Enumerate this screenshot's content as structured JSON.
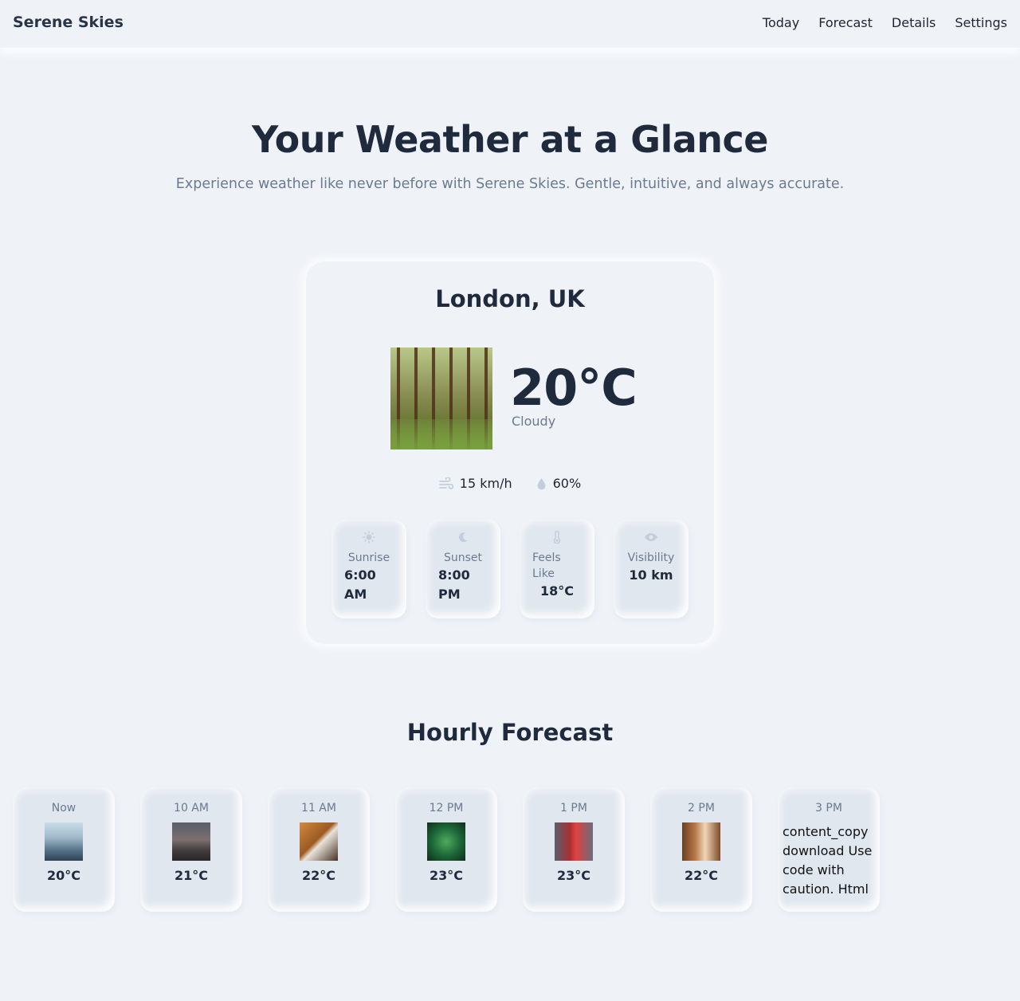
{
  "header": {
    "brand": "Serene Skies",
    "nav": [
      "Today",
      "Forecast",
      "Details",
      "Settings"
    ]
  },
  "hero": {
    "title": "Your Weather at a Glance",
    "subtitle": "Experience weather like never before with Serene Skies. Gentle, intuitive, and always accurate."
  },
  "current": {
    "city": "London, UK",
    "temperature": "20°C",
    "condition": "Cloudy",
    "wind": "15 km/h",
    "humidity": "60%",
    "stats": [
      {
        "icon": "sun-icon",
        "label": "Sunrise",
        "value": "6:00 AM"
      },
      {
        "icon": "moon-icon",
        "label": "Sunset",
        "value": "8:00 PM"
      },
      {
        "icon": "thermometer-icon",
        "label": "Feels Like",
        "value": "18°C"
      },
      {
        "icon": "eye-icon",
        "label": "Visibility",
        "value": "10 km"
      }
    ]
  },
  "hourly": {
    "title": "Hourly Forecast",
    "items": [
      {
        "time": "Now",
        "temp": "20°C"
      },
      {
        "time": "10 AM",
        "temp": "21°C"
      },
      {
        "time": "11 AM",
        "temp": "22°C"
      },
      {
        "time": "12 PM",
        "temp": "23°C"
      },
      {
        "time": "1 PM",
        "temp": "23°C"
      },
      {
        "time": "2 PM",
        "temp": "22°C"
      },
      {
        "time": "3 PM",
        "text": "content_copy download Use code with caution. Html"
      }
    ]
  },
  "colors": {
    "background": "#eff3f8",
    "text_primary": "#1f2a3d",
    "text_muted": "#6b7a90",
    "tile": "#e1e7ef",
    "icon_muted": "#c3cedd"
  }
}
